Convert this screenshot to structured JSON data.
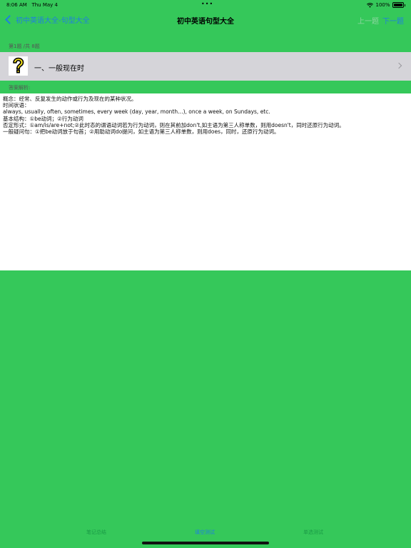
{
  "status_bar": {
    "time": "8:06 AM",
    "date": "Thu May 4",
    "dots": "•••",
    "battery_pct": "100%"
  },
  "nav": {
    "back_label": "初中英语大全-句型大全",
    "title": "初中英语句型大全",
    "prev_label": "上一题",
    "next_label": "下一题"
  },
  "question": {
    "count_text": "第1题 /共 8题",
    "title": "一、一般现在时"
  },
  "answer": {
    "label": "答案解析:",
    "lines": [
      "概念：经常、反复发生的动作或行为及现在的某种状况。",
      "时间状语：",
      "always, usually, often, sometimes, every week (day, year, month…), once a week, on Sundays, etc.",
      "基本结构：①be动词；②行为动词",
      "否定形式：①am/is/are+not;②此时态的谓语动词若为行为动词，则在其前加don't,如主语为第三人称单数，则用doesn't，同时还原行为动词。",
      "一般疑问句：①把be动词放于句首；②用助动词do提问，如主语为第三人称单数，则用does，同时，还原行为动词。"
    ]
  },
  "tabs": [
    {
      "label": "笔记总结"
    },
    {
      "label": "填空测试"
    },
    {
      "label": "单选测试"
    }
  ],
  "colors": {
    "background": "#35c85a",
    "accent": "#1f7fe0",
    "row": "#d5d4d9"
  }
}
